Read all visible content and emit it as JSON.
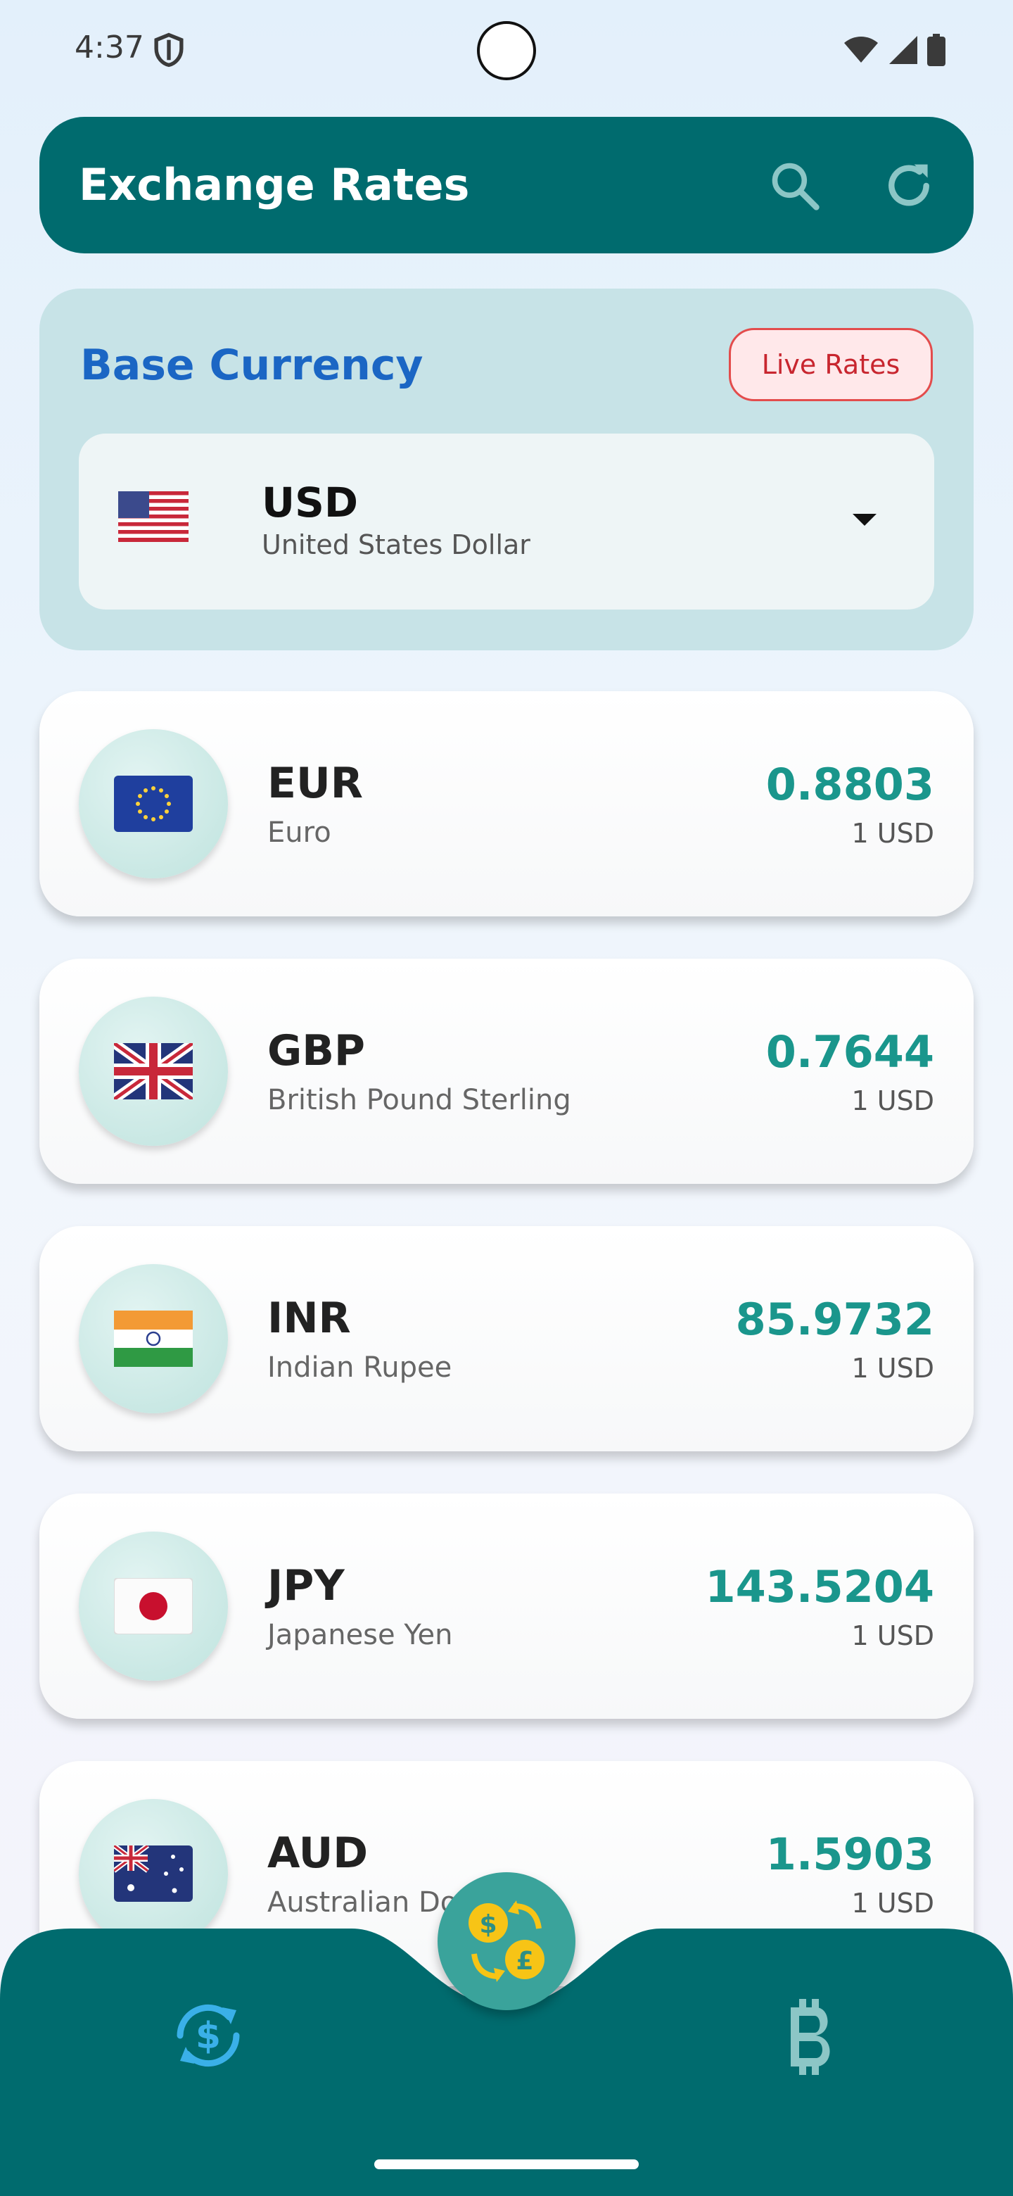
{
  "status_bar": {
    "time": "4:37"
  },
  "app_bar": {
    "title": "Exchange Rates",
    "search_icon": "search-icon",
    "refresh_icon": "refresh-icon"
  },
  "base_currency": {
    "title": "Base Currency",
    "live_badge": "Live Rates",
    "selected": {
      "code": "USD",
      "name": "United States Dollar",
      "flag": "us-flag-icon"
    }
  },
  "rates": [
    {
      "code": "EUR",
      "name": "Euro",
      "value": "0.8803",
      "unit": "1 USD",
      "flag": "eu-flag-icon"
    },
    {
      "code": "GBP",
      "name": "British Pound Sterling",
      "value": "0.7644",
      "unit": "1 USD",
      "flag": "uk-flag-icon"
    },
    {
      "code": "INR",
      "name": "Indian Rupee",
      "value": "85.9732",
      "unit": "1 USD",
      "flag": "india-flag-icon"
    },
    {
      "code": "JPY",
      "name": "Japanese Yen",
      "value": "143.5204",
      "unit": "1 USD",
      "flag": "japan-flag-icon"
    },
    {
      "code": "AUD",
      "name": "Australian Dollar",
      "value": "1.5903",
      "unit": "1 USD",
      "flag": "australia-flag-icon"
    }
  ],
  "bottom_nav": {
    "items": [
      {
        "icon": "currency-exchange-icon"
      },
      {
        "icon": "convert-icon"
      },
      {
        "icon": "bitcoin-icon"
      }
    ]
  },
  "colors": {
    "primary": "#006b6e",
    "accent": "#1a968c",
    "title_blue": "#1b66c4",
    "badge_red": "#c8262f",
    "nav_active": "#3ab0e8"
  }
}
